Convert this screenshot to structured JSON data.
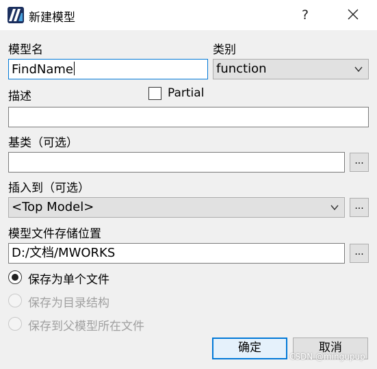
{
  "window": {
    "title": "新建模型",
    "help_label": "?",
    "icons": {
      "logo": "mworks-logo-icon",
      "close": "close-icon"
    }
  },
  "form": {
    "model_name_label": "模型名",
    "model_name_value": "FindName",
    "category_label": "类别",
    "category_value": "function",
    "description_label": "描述",
    "description_value": "",
    "partial_label": "Partial",
    "partial_checked": false,
    "base_class_label": "基类（可选）",
    "base_class_value": "",
    "browse_label": "...",
    "insert_label": "插入到（可选）",
    "insert_value": "<Top Model>",
    "storage_label": "模型文件存储位置",
    "storage_value": "D:/文档/MWORKS"
  },
  "save_options": [
    {
      "label": "保存为单个文件",
      "selected": true,
      "enabled": true
    },
    {
      "label": "保存为目录结构",
      "selected": false,
      "enabled": false
    },
    {
      "label": "保存到父模型所在文件",
      "selected": false,
      "enabled": false
    }
  ],
  "buttons": {
    "ok": "确定",
    "cancel": "取消"
  },
  "watermark": "CSDN @mingupup"
}
